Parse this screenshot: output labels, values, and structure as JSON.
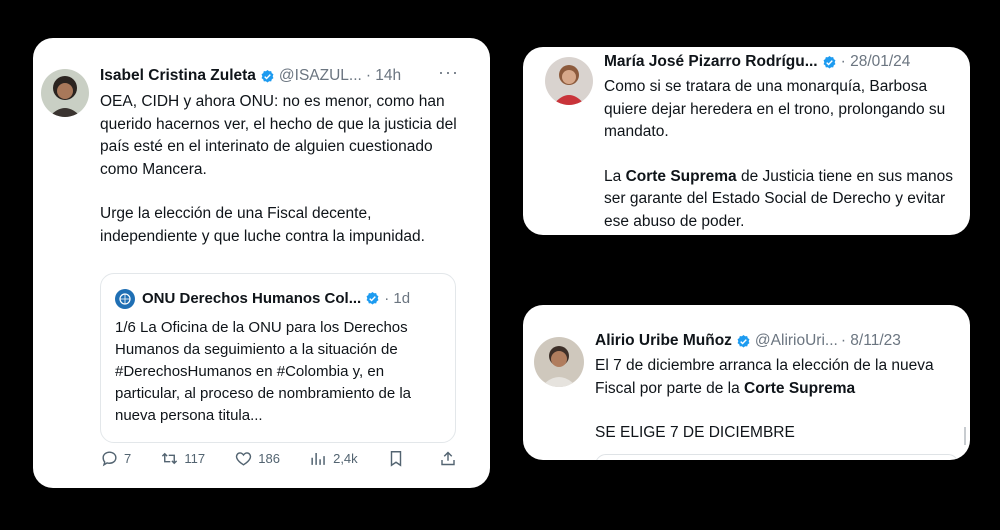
{
  "tweet1": {
    "author_name": "Isabel Cristina Zuleta",
    "handle": "@ISAZUL...",
    "time": "· 14h",
    "more": "···",
    "paragraph1": "OEA, CIDH y ahora ONU: no es menor, como han querido hacernos ver, el hecho de que la justicia del país esté en el interinato de alguien cuestionado como Mancera.",
    "paragraph2": "Urge la elección de una Fiscal decente, independiente y que luche contra la impunidad.",
    "quote": {
      "author_name": "ONU Derechos Humanos Col...",
      "time": "· 1d",
      "text": "1/6 La Oficina de la ONU para los Derechos Humanos da seguimiento a la situación de #DerechosHumanos en #Colombia y, en particular, al proceso de nombramiento de la nueva persona titula..."
    },
    "actions": {
      "replies": "7",
      "reposts": "117",
      "likes": "186",
      "views": "2,4k"
    }
  },
  "tweet2": {
    "author_name": "María José Pizarro Rodrígu...",
    "time": "· 28/01/24",
    "paragraph1": "Como si se tratara de una monarquía, Barbosa quiere dejar heredera en el trono, prolongando su mandato.",
    "p2_part1": "La ",
    "p2_bold": "Corte Suprema",
    "p2_part2": " de Justicia tiene en sus manos ser garante del Estado Social de Derecho y evitar ese abuso de poder."
  },
  "tweet3": {
    "author_name": "Alirio Uribe Muñoz",
    "handle": "@AlirioUri...",
    "time": "· 8/11/23",
    "p1_part1": "El 7 de diciembre arranca la elección de la nueva Fiscal por parte de la ",
    "p1_bold": "Corte Suprema",
    "paragraph2": "SE ELIGE 7 DE DICIEMBRE"
  },
  "colors": {
    "background": "#000000",
    "card": "#ffffff",
    "verified": "#1d9bf0",
    "muted": "#6b7580"
  },
  "icons": [
    "verified-badge-icon",
    "reply-icon",
    "repost-icon",
    "like-icon",
    "views-icon",
    "bookmark-icon",
    "share-icon",
    "more-icon"
  ]
}
